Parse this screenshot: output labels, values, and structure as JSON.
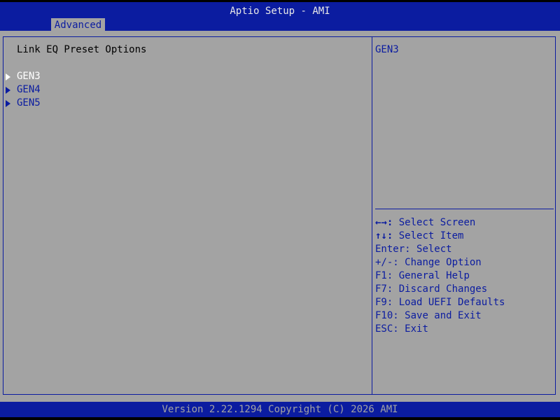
{
  "header": {
    "title": "Aptio Setup - AMI",
    "tabs": [
      {
        "label": "Advanced",
        "active": true
      }
    ]
  },
  "main": {
    "heading": "Link EQ Preset Options",
    "items": [
      {
        "label": "GEN3",
        "selected": true
      },
      {
        "label": "GEN4",
        "selected": false
      },
      {
        "label": "GEN5",
        "selected": false
      }
    ]
  },
  "help": {
    "title": "GEN3"
  },
  "keys": [
    {
      "key": "←→:",
      "action": "Select Screen"
    },
    {
      "key": "↑↓:",
      "action": "Select Item"
    },
    {
      "key": "Enter:",
      "action": "Select"
    },
    {
      "key": "+/-:",
      "action": "Change Option"
    },
    {
      "key": "F1:",
      "action": "General Help"
    },
    {
      "key": "F7:",
      "action": "Discard Changes"
    },
    {
      "key": "F9:",
      "action": "Load UEFI Defaults"
    },
    {
      "key": "F10:",
      "action": "Save and Exit"
    },
    {
      "key": "ESC:",
      "action": "Exit"
    }
  ],
  "footer": {
    "version": "Version 2.22.1294 Copyright (C) 2026 AMI"
  },
  "colors": {
    "bar_blue": "#0b1ca0",
    "panel_gray": "#a3a3a3",
    "selected_text": "#ffffff"
  }
}
